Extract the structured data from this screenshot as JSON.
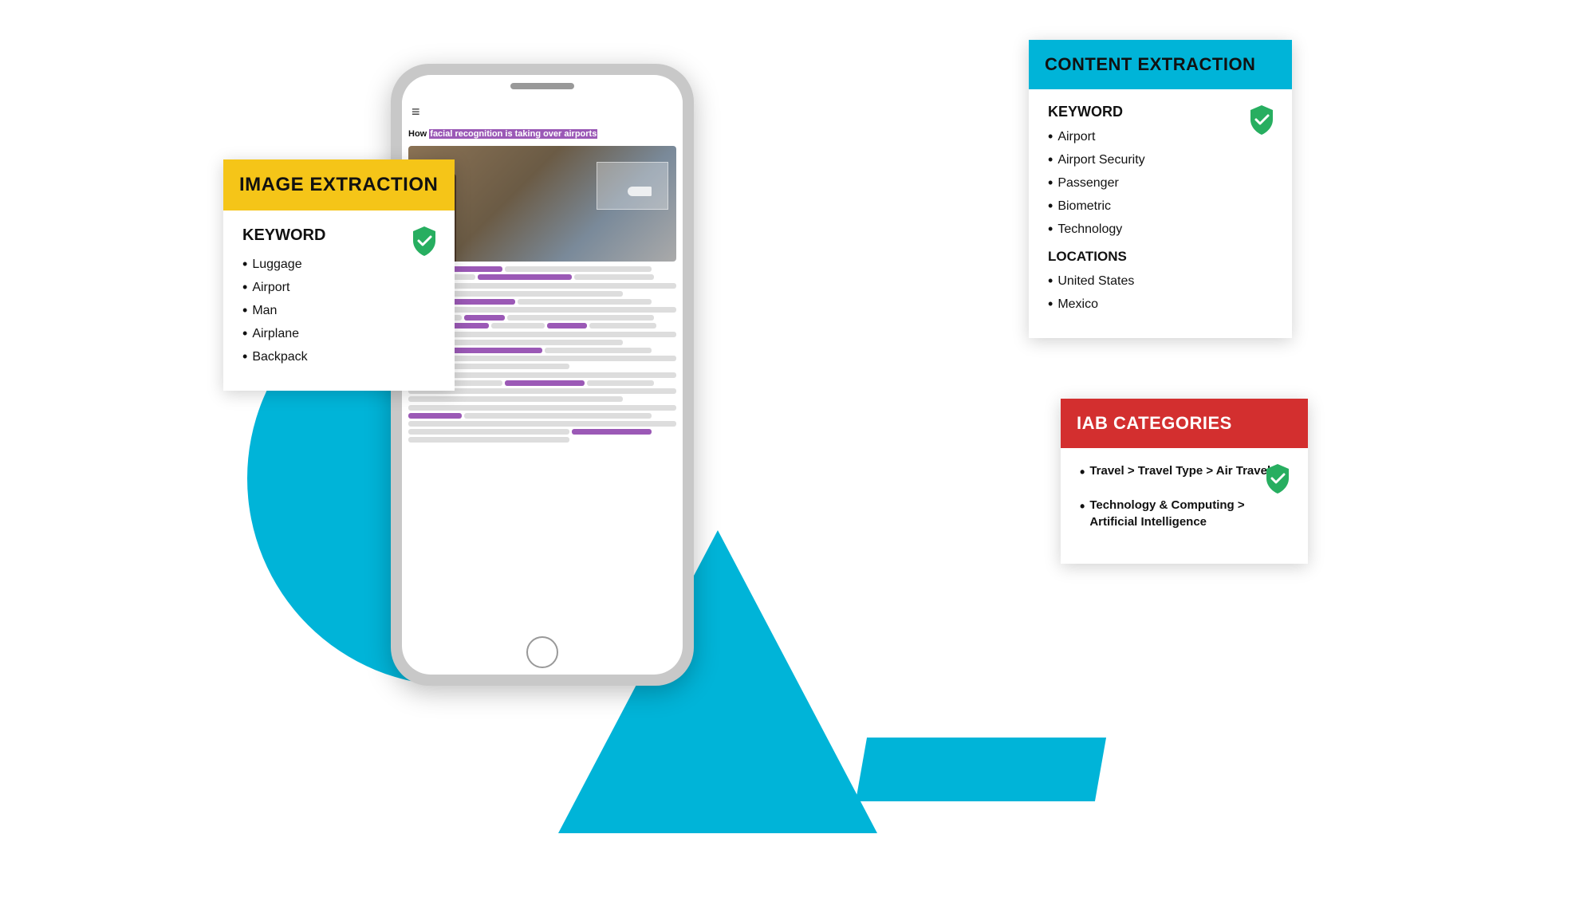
{
  "background": {
    "colors": {
      "blue": "#00b4d8",
      "black": "#111111",
      "white": "#ffffff"
    }
  },
  "image_extraction": {
    "header": "IMAGE EXTRACTION",
    "keyword_label": "KEYWORD",
    "keywords": [
      "Luggage",
      "Airport",
      "Man",
      "Airplane",
      "Backpack"
    ]
  },
  "content_extraction": {
    "header": "CONTENT EXTRACTION",
    "keyword_label": "KEYWORD",
    "keywords": [
      "Airport",
      "Airport Security",
      "Passenger",
      "Biometric",
      "Technology"
    ],
    "locations_label": "LOCATIONS",
    "locations": [
      "United States",
      "Mexico"
    ]
  },
  "iab_categories": {
    "header": "IAB CATEGORIES",
    "items": [
      "Travel > Travel Type > Air Travel",
      "Technology & Computing > Artificial Intelligence"
    ]
  },
  "phone": {
    "article_title_plain": "How ",
    "article_title_highlight": "facial recognition is taking over airports",
    "menu_icon": "≡"
  }
}
